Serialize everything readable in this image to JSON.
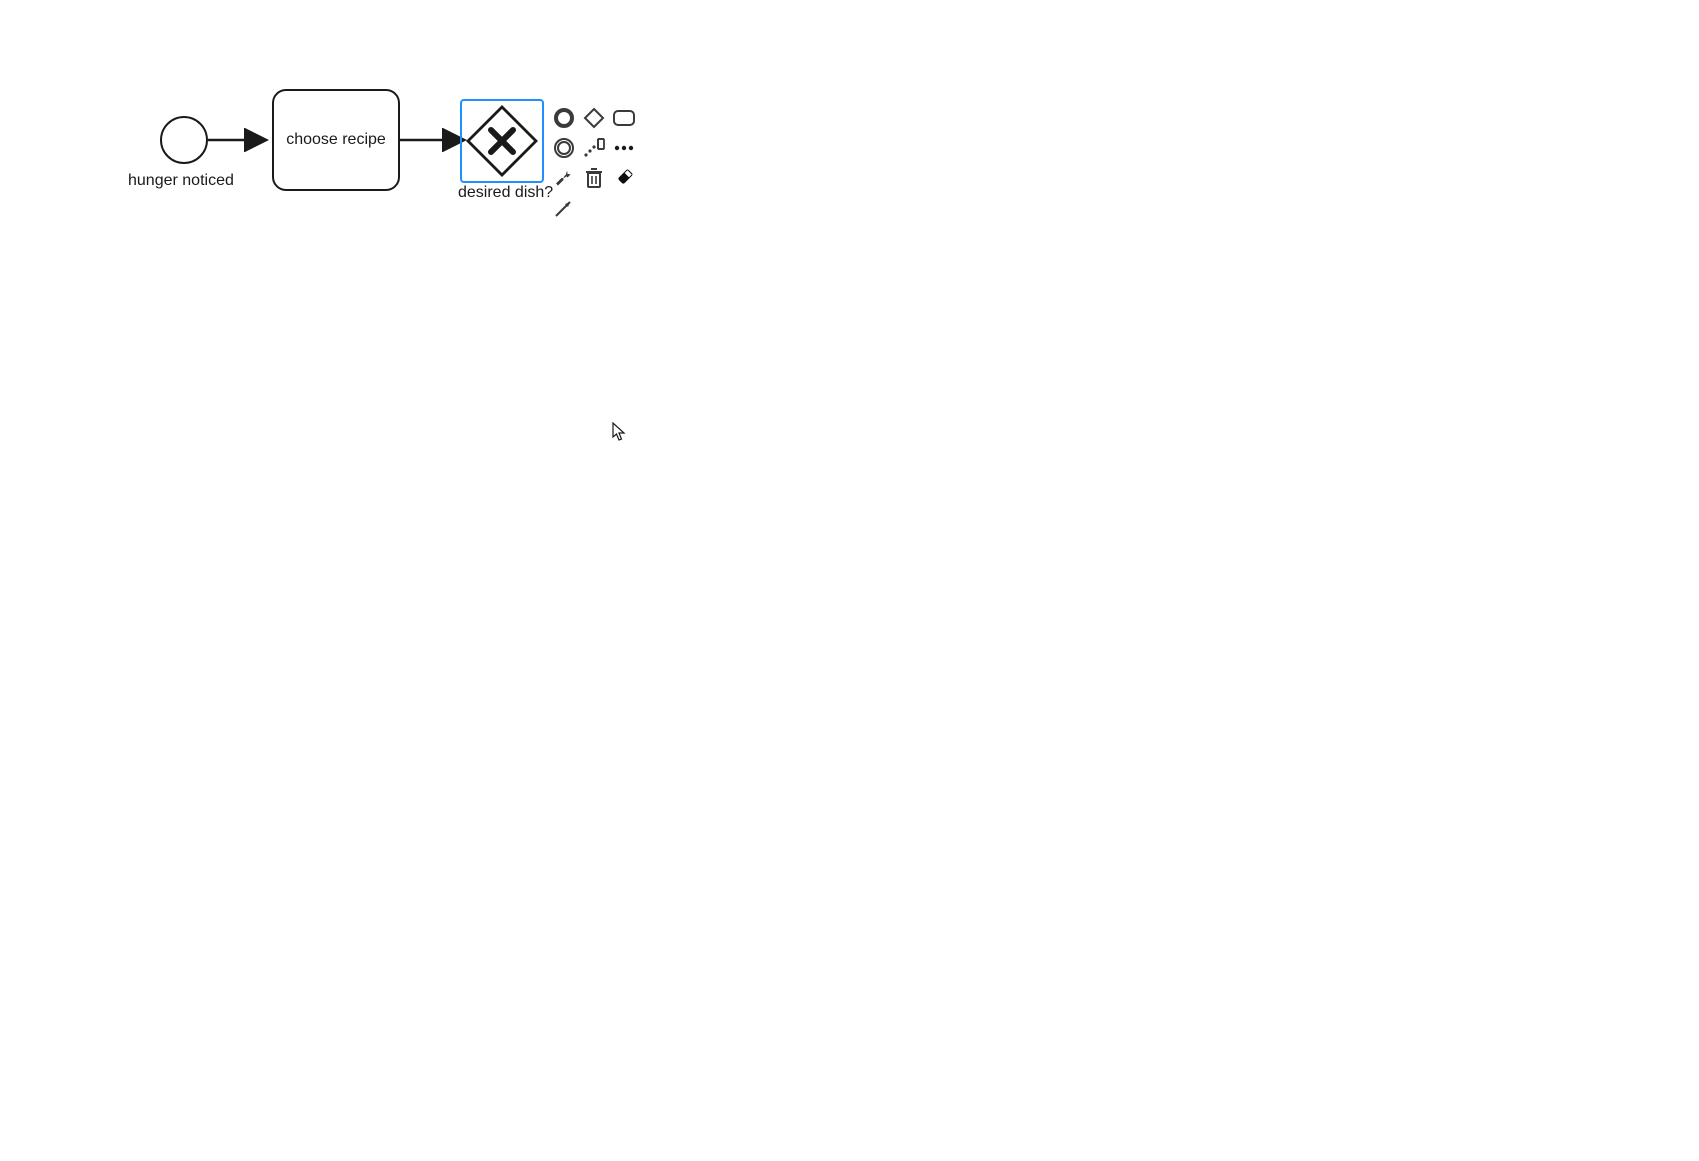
{
  "diagram": {
    "start_event": {
      "label": "hunger noticed"
    },
    "task1": {
      "label": "choose recipe"
    },
    "gateway1": {
      "label": "desired dish?"
    }
  },
  "context_pad": {
    "items": [
      {
        "name": "append-end-event-icon"
      },
      {
        "name": "append-gateway-icon"
      },
      {
        "name": "append-task-icon"
      },
      {
        "name": "append-intermediate-event-icon"
      },
      {
        "name": "connect-sequence-icon"
      },
      {
        "name": "more-options-icon"
      },
      {
        "name": "wrench-icon"
      },
      {
        "name": "trash-icon"
      },
      {
        "name": "color-icon"
      },
      {
        "name": "connect-icon"
      }
    ]
  }
}
